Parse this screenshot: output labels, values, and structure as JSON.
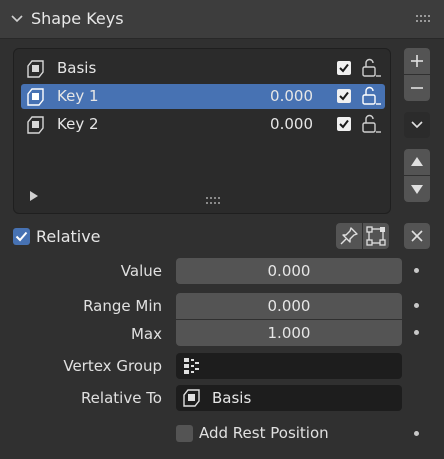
{
  "panel": {
    "title": "Shape Keys"
  },
  "shape_keys": [
    {
      "name": "Basis",
      "value": "",
      "checked": true,
      "selected": false
    },
    {
      "name": "Key 1",
      "value": "0.000",
      "checked": true,
      "selected": true
    },
    {
      "name": "Key 2",
      "value": "0.000",
      "checked": true,
      "selected": false
    }
  ],
  "relative": {
    "label": "Relative",
    "checked": true
  },
  "properties": {
    "value": {
      "label": "Value",
      "value": "0.000"
    },
    "range_min": {
      "label": "Range Min",
      "value": "0.000"
    },
    "max": {
      "label": "Max",
      "value": "1.000"
    },
    "vertex_group": {
      "label": "Vertex Group",
      "value": ""
    },
    "relative_to": {
      "label": "Relative To",
      "value": "Basis"
    },
    "add_rest_position": {
      "label": "Add Rest Position",
      "checked": false
    }
  },
  "colors": {
    "accent": "#4772b3",
    "panel_bg": "#303030",
    "header_bg": "#3d3d3d",
    "field_bg": "#545454",
    "list_bg": "#2b2b2b"
  },
  "icons": [
    "chevron-down-icon",
    "grip-icon",
    "shape-key-icon",
    "lock-icon",
    "play-icon",
    "plus-icon",
    "minus-icon",
    "menu-chevron-icon",
    "arrow-up-icon",
    "arrow-down-icon",
    "pin-icon",
    "edit-mode-icon",
    "close-icon",
    "vertex-group-icon",
    "keyframe-dot-icon"
  ]
}
